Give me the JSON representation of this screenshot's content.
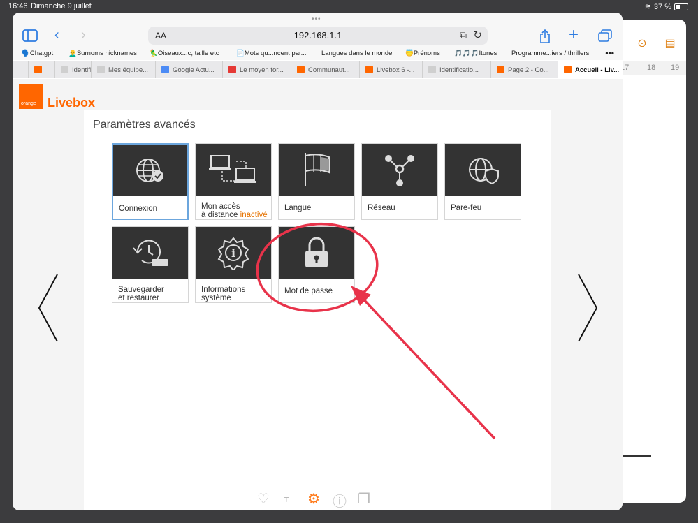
{
  "status_bar": {
    "time": "16:46",
    "date": "Dimanche 9 juillet",
    "battery": "37 %",
    "battery_level": 0.37
  },
  "background_window": {
    "ruler_marks": [
      "17",
      "18",
      "19"
    ],
    "more_icon": "ellipsis-circle-icon",
    "doc_icon": "document-icon"
  },
  "browser": {
    "address_prefix": "AA",
    "url": "192.168.1.1",
    "bookmarks": [
      "🗣️Chatgpt",
      "👨‍🦲Surnoms nicknames",
      "🦜Oiseaux...c, taille etc",
      "📄Mots qu...ncent par...",
      "Langues dans le monde",
      "😇Prénoms",
      "🎵🎵🎵Itunes",
      "Programme...iers / thrillers"
    ],
    "tabs": [
      {
        "label": "",
        "color": "#ff6600"
      },
      {
        "label": "Identifi",
        "color": "#cfcfcf"
      },
      {
        "label": "Mes équipe...",
        "color": "#cfcfcf"
      },
      {
        "label": "Google Actu...",
        "color": "#4c8bf5"
      },
      {
        "label": "Le moyen for...",
        "color": "#e53935"
      },
      {
        "label": "Communaut...",
        "color": "#ff6600"
      },
      {
        "label": "Livebox 6 -...",
        "color": "#ff6600"
      },
      {
        "label": "Identificatio...",
        "color": "#cfcfcf"
      },
      {
        "label": "Page 2 - Co...",
        "color": "#ff6600"
      },
      {
        "label": "Accueil - Liv...",
        "color": "#ff6600"
      }
    ]
  },
  "page": {
    "logo_text": "orange",
    "brand": "Livebox",
    "title": "Paramètres avancés",
    "tiles": [
      {
        "label": "Connexion",
        "icon": "globe-check-icon"
      },
      {
        "label_1": "Mon accès",
        "label_2": "à distance",
        "status": "inactivé",
        "icon": "remote-computers-icon"
      },
      {
        "label": "Langue",
        "icon": "flag-icon"
      },
      {
        "label": "Réseau",
        "icon": "network-icon"
      },
      {
        "label": "Pare-feu",
        "icon": "globe-shield-icon"
      },
      {
        "label_1": "Sauvegarder",
        "label_2": "et restaurer",
        "icon": "backup-restore-icon"
      },
      {
        "label_1": "Informations",
        "label_2": "système",
        "icon": "info-gear-icon"
      },
      {
        "label": "Mot de passe",
        "icon": "padlock-icon"
      }
    ]
  },
  "annotation": {
    "color": "#e8334a",
    "shape": "circle and arrow pointing to Mot de passe"
  }
}
